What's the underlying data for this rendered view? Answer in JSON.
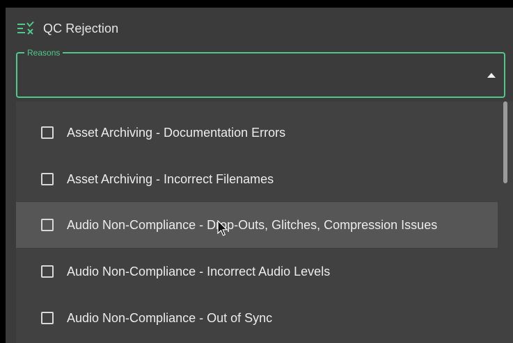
{
  "header": {
    "title": "QC Rejection",
    "icon": "checklist-reject-icon"
  },
  "field": {
    "legend": "Reasons",
    "value": "",
    "accent_color": "#4fc98a"
  },
  "dropdown": {
    "options": [
      {
        "label": "Asset Archiving - Documentation Errors",
        "checked": false
      },
      {
        "label": "Asset Archiving - Incorrect Filenames",
        "checked": false
      },
      {
        "label": "Audio Non-Compliance - Drop-Outs, Glitches, Compression Issues",
        "checked": false,
        "hovered": true
      },
      {
        "label": "Audio Non-Compliance - Incorrect Audio Levels",
        "checked": false
      },
      {
        "label": "Audio Non-Compliance - Out of Sync",
        "checked": false
      }
    ]
  }
}
